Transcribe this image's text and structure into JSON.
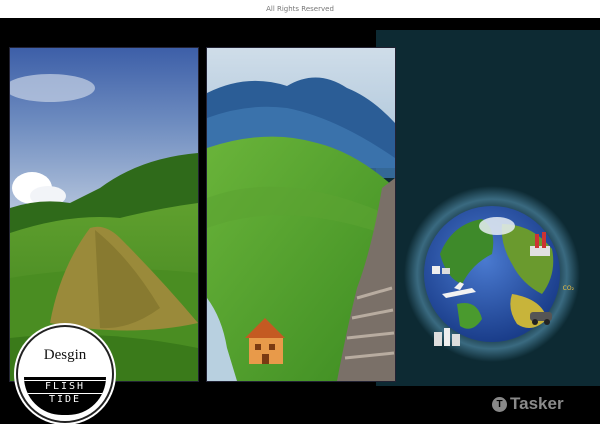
{
  "header": {
    "copyright": "All Rights Reserved"
  },
  "logo": {
    "word": "Desgin",
    "brand_line1": "FLISH",
    "brand_line2": "TIDE"
  },
  "watermark": {
    "brand": "Tasker"
  },
  "earth": {
    "co2_label": "CO₂"
  },
  "colors": {
    "stage": "#000000",
    "teal": "#0d2a33",
    "sky": "#4a6fb0",
    "grass": "#4f9a2a",
    "hay": "#9a8a3a"
  }
}
